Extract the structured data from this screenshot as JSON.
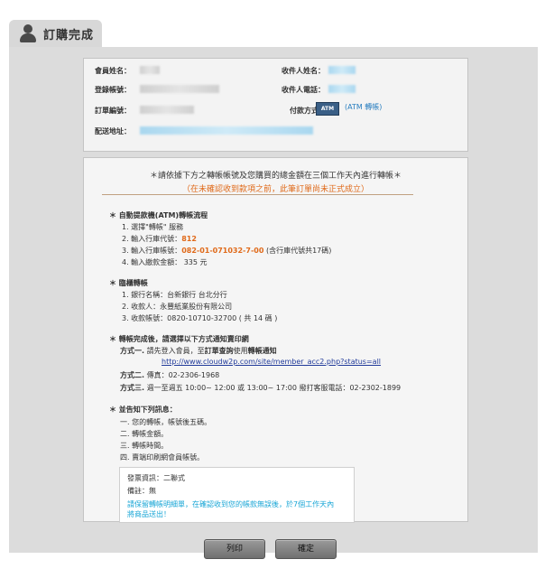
{
  "tab": {
    "title": "訂購完成"
  },
  "member": {
    "name_label": "會員姓名：",
    "account_label": "登錄帳號：",
    "order_label": "訂單編號：",
    "address_label": "配送地址：",
    "recipient_label": "收件人姓名：",
    "phone_label": "收件人電話：",
    "payment_label": "付款方式：",
    "atm_icon_text": "ATM",
    "payment_value": "(ATM 轉帳)"
  },
  "notice": {
    "line1": "＊請依據下方之轉帳帳號及您購買的總金額在三個工作天內進行轉帳＊",
    "line2": "（在未確認收到款項之前，此筆訂單尚未正式成立）"
  },
  "atm_section": {
    "header": "＊ 自動提款機(ATM)轉帳流程",
    "step1": "1. 選擇\"轉帳\" 服務",
    "step2_prefix": "2. 輸入行庫代號：",
    "bank_code": "812",
    "step3_prefix": "3. 輸入行庫帳號：",
    "account_no": "082-01-071032-7-00",
    "step3_suffix": " (含行庫代號共17碼)",
    "step4": "4. 輸入繳款金額： 335 元"
  },
  "counter_section": {
    "header": "＊ 臨櫃轉帳",
    "item1": "1. 銀行名稱：台新銀行 台北分行",
    "item2": "2. 收款人：永豐紙業股份有限公司",
    "item3": "3. 收款帳號：0820-10710-32700 ( 共 14 碼 )"
  },
  "notify_section": {
    "header": "＊ 轉帳完成後，請選擇以下方式通知賣印網",
    "method1_label": "方式一.",
    "method1_a": " 請先登入會員，至",
    "method1_b": "訂單查詢",
    "method1_c": "使用",
    "method1_d": "轉帳通知",
    "link": "http://www.cloudw2p.com/site/member_acc2.php?status=all",
    "method2_label": "方式二.",
    "method2": " 傳真：02-2306-1968",
    "method3_label": "方式三.",
    "method3": " 週一至週五 10:00~ 12:00 或 13:00~ 17:00 撥打客服電話：02-2302-1899"
  },
  "inform_section": {
    "header": "＊ 並告知下列訊息：",
    "item1": "一. 您的轉帳，帳號後五碼。",
    "item2": "二. 轉帳金額。",
    "item3": "三. 轉帳時間。",
    "item4": "四. 賣端印刷網會員帳號。"
  },
  "info_box": {
    "invoice": "發票資訊：二聯式",
    "remark": "備註：無",
    "note1": "請保留轉帳明細單，在確認收到您的帳款無誤後，於7個工作天內",
    "note2": "將商品送出！"
  },
  "buttons": {
    "print": "列印",
    "confirm": "確定"
  }
}
